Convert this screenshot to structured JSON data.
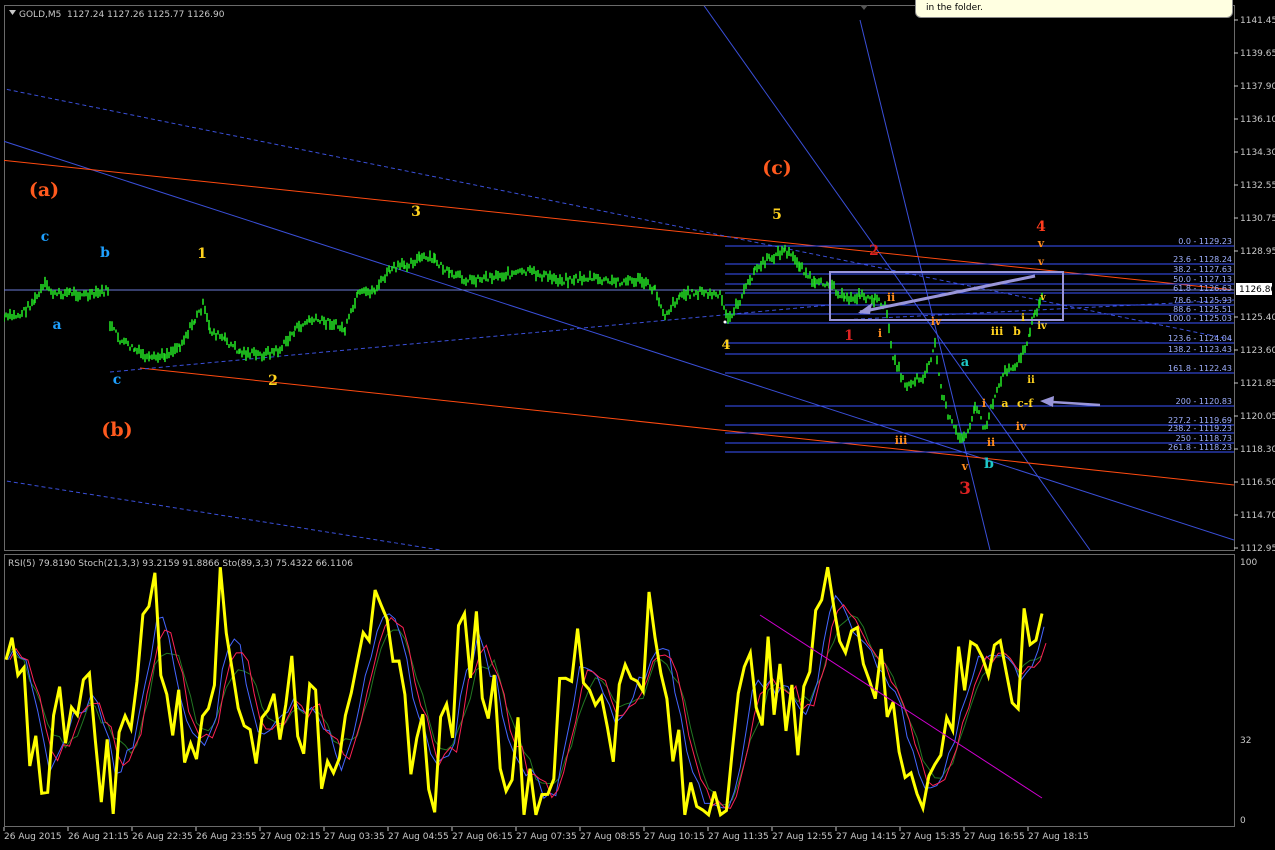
{
  "window": {
    "title": "GOLD,M5",
    "ohlc": "1127.24 1127.26 1125.77 1126.90",
    "indicator_header": "RSI(5) 79.8190  Stoch(21,3,3) 93.2159 91.8866  Sto(89,3,3) 75.4322 66.1106",
    "tooltip_text": "in the folder.",
    "current_price_label": "1126.80"
  },
  "price_axis": {
    "labels": [
      "1141.45",
      "1139.65",
      "1137.90",
      "1136.10",
      "1134.30",
      "1132.55",
      "1130.75",
      "1128.95",
      "1126.80",
      "1125.40",
      "1123.60",
      "1121.85",
      "1120.05",
      "1118.30",
      "1116.50",
      "1114.70",
      "1112.95"
    ]
  },
  "indicator_axis": {
    "labels": [
      "100",
      "32",
      "0"
    ]
  },
  "time_axis": {
    "labels": [
      "26 Aug 2015",
      "26 Aug 21:15",
      "26 Aug 22:35",
      "26 Aug 23:55",
      "27 Aug 02:15",
      "27 Aug 03:35",
      "27 Aug 04:55",
      "27 Aug 06:15",
      "27 Aug 07:35",
      "27 Aug 08:55",
      "27 Aug 10:15",
      "27 Aug 11:35",
      "27 Aug 12:55",
      "27 Aug 14:15",
      "27 Aug 15:35",
      "27 Aug 16:55",
      "27 Aug 18:15"
    ]
  },
  "fib_levels": {
    "labels": [
      "0.0 - 1129.23",
      "23.6 - 1128.24",
      "38.2 - 1127.63",
      "50.0 - 1127.13",
      "61.8 - 1126.63",
      "78.6 - 1125.93",
      "88.6 - 1125.51",
      "100.0 - 1125.03",
      "123.6 - 1124.04",
      "138.2 - 1123.43",
      "161.8 - 1122.43",
      "200 - 1120.83",
      "227.2 - 1119.69",
      "238.2 - 1119.23",
      "250 - 1118.73",
      "261.8 - 1118.23"
    ]
  },
  "wave_labels": [
    {
      "text": "(a)",
      "color": "#ff5a1e"
    },
    {
      "text": "c",
      "color": "#1ea0ff"
    },
    {
      "text": "a",
      "color": "#1ea0ff"
    },
    {
      "text": "b",
      "color": "#1ea0ff"
    },
    {
      "text": "c",
      "color": "#1ea0ff"
    },
    {
      "text": "(b)",
      "color": "#ff5a1e"
    },
    {
      "text": "1",
      "color": "#ffd21e"
    },
    {
      "text": "2",
      "color": "#ffd21e"
    },
    {
      "text": "3",
      "color": "#ffd21e"
    },
    {
      "text": "4",
      "color": "#ffd21e"
    },
    {
      "text": "5",
      "color": "#ffd21e"
    },
    {
      "text": "(c)",
      "color": "#ff5a1e"
    },
    {
      "text": "4",
      "color": "#ff3c1e"
    },
    {
      "text": "v",
      "color": "#ff8c1e"
    },
    {
      "text": "v",
      "color": "#ff8c1e"
    },
    {
      "text": "1",
      "color": "#dd2222"
    },
    {
      "text": "2",
      "color": "#dd2222"
    },
    {
      "text": "3",
      "color": "#dd2222"
    },
    {
      "text": "i",
      "color": "#ff8c1e"
    },
    {
      "text": "ii",
      "color": "#ff8c1e"
    },
    {
      "text": "iii",
      "color": "#ff8c1e"
    },
    {
      "text": "iv",
      "color": "#ff8c1e"
    },
    {
      "text": "v",
      "color": "#ff8c1e"
    },
    {
      "text": "a",
      "color": "#1ec8c8"
    },
    {
      "text": "b",
      "color": "#1ec8c8"
    },
    {
      "text": "i",
      "color": "#ff8c1e"
    },
    {
      "text": "ii",
      "color": "#ff8c1e"
    },
    {
      "text": "iii",
      "color": "#ffd21e"
    },
    {
      "text": "b",
      "color": "#ffd21e"
    },
    {
      "text": "i",
      "color": "#ffd21e"
    },
    {
      "text": "ii",
      "color": "#ffd21e"
    },
    {
      "text": "iv",
      "color": "#ffd21e"
    },
    {
      "text": "iv",
      "color": "#ff8c1e"
    },
    {
      "text": "a",
      "color": "#ffd21e"
    },
    {
      "text": "c-f",
      "color": "#ffd21e"
    },
    {
      "text": "v",
      "color": "#ffd21e"
    }
  ],
  "colors": {
    "candle": "#22dd22",
    "rsi": "#ffff00",
    "stoch_main": "#4466ff",
    "stoch_signal": "#ff2255",
    "sto_slow": "#227722",
    "trend_blue": "#3a4fd8",
    "trend_red": "#ff4a10",
    "fib": "#3a55ff",
    "box": "#9a96d8",
    "magenta_line": "#d000d0"
  },
  "chart_data": [
    {
      "type": "line",
      "title": "GOLD,M5",
      "series": [
        {
          "name": "GOLD,M5",
          "x": [
            "26 Aug 2015",
            "26 Aug 21:15",
            "26 Aug 22:35",
            "26 Aug 23:55",
            "27 Aug 02:15",
            "27 Aug 03:35",
            "27 Aug 04:55",
            "27 Aug 06:15",
            "27 Aug 07:35",
            "27 Aug 08:55",
            "27 Aug 10:15",
            "27 Aug 11:35",
            "27 Aug 12:55",
            "27 Aug 14:15",
            "27 Aug 15:35",
            "27 Aug 16:55",
            "27 Aug 18:15"
          ],
          "y": [
            1125.2,
            1126.9,
            1123.6,
            1124.5,
            1123.9,
            1126.5,
            1127.9,
            1127.2,
            1127.3,
            1126.5,
            1125.9,
            1126.6,
            1128.7,
            1126.6,
            1119.6,
            1121.6,
            1126.9
          ]
        }
      ],
      "ylim": [
        1112.95,
        1141.45
      ],
      "grid": false
    },
    {
      "type": "line",
      "title": "RSI(5) 79.8190  Stoch(21,3,3) 93.2159 91.8866  Sto(89,3,3) 75.4322 66.1106",
      "series": [
        {
          "name": "RSI(5)",
          "values": [
            60,
            20,
            58,
            10,
            90,
            25,
            80,
            30,
            55,
            20,
            85,
            45,
            20,
            75,
            30,
            10,
            65,
            40,
            75,
            5,
            15,
            60,
            35,
            95,
            70,
            30,
            15,
            75,
            45,
            80
          ]
        }
      ],
      "ylim": [
        0,
        100
      ],
      "grid": false
    }
  ]
}
